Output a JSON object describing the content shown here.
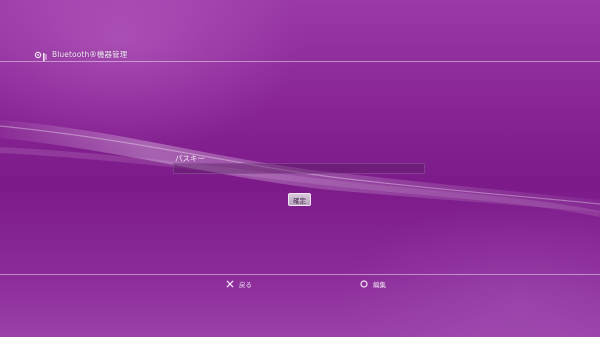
{
  "header": {
    "title": "Bluetooth®機器管理",
    "icon": "bluetooth-settings-icon"
  },
  "form": {
    "passkey_label": "パスキー",
    "passkey_value": "",
    "confirm_label": "確定"
  },
  "footer": {
    "back_label": "戻る",
    "back_icon": "cross-button-icon",
    "edit_label": "編集",
    "edit_icon": "circle-button-icon"
  },
  "colors": {
    "background": "#8a2696",
    "accent": "#ffffff"
  }
}
